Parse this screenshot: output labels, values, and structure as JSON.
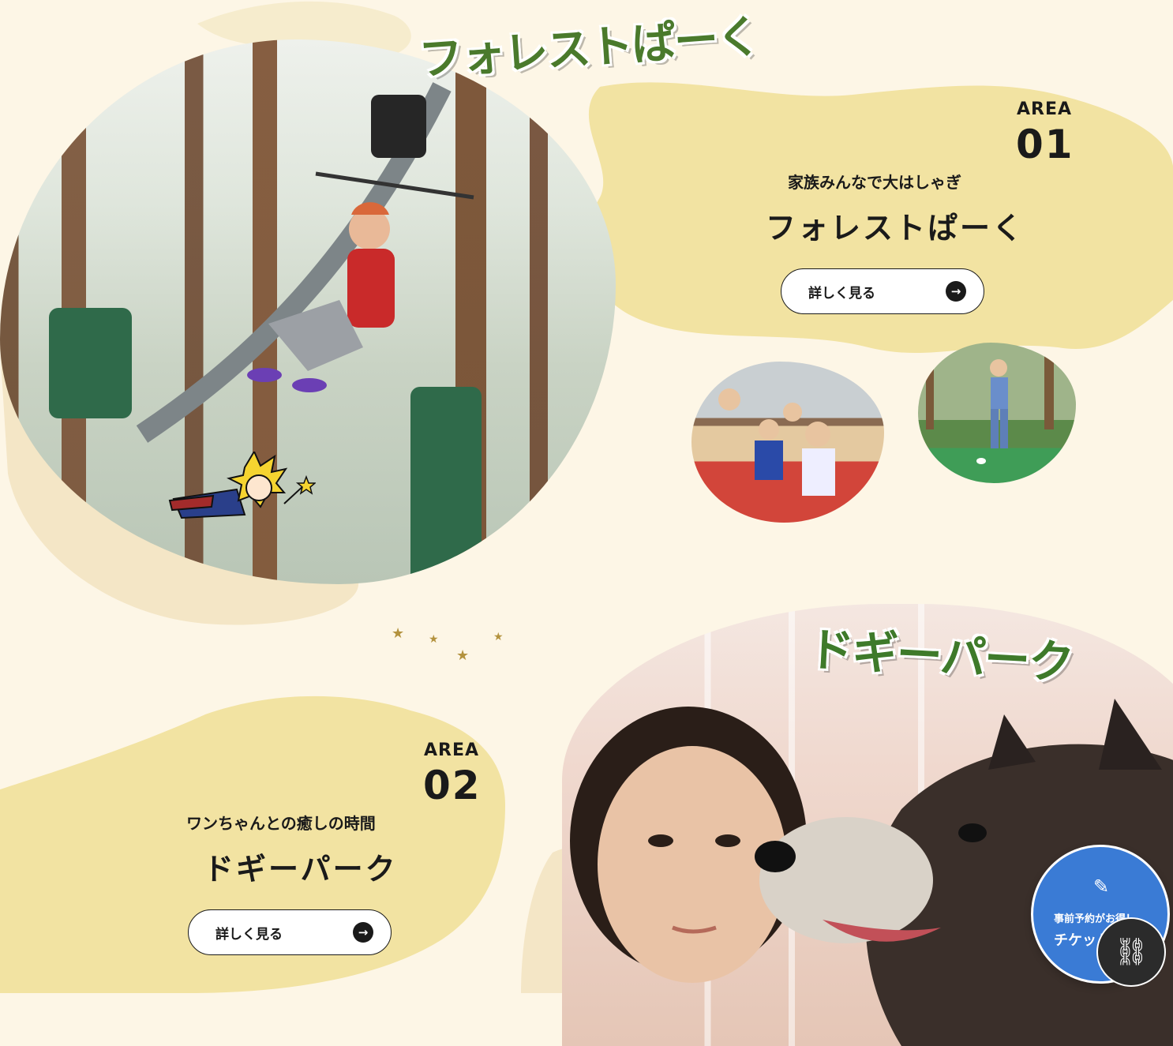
{
  "colors": {
    "background": "#fdf6e6",
    "yellow_blob": "#f2e3a2",
    "sand_blob": "#f4e6c6",
    "logo_green": "#4a7a2c",
    "ticket_blue": "#3a7bd5",
    "star_gold": "#b3923e"
  },
  "area1": {
    "logo_text": "フォレストぱーく",
    "area_label": "AREA",
    "area_number": "01",
    "tagline": "家族みんなで大はしゃぎ",
    "title": "フォレストぱーく",
    "button_label": "詳しく見る",
    "button_icon": "arrow-right-icon"
  },
  "area2": {
    "logo_text": "ドギーパーク",
    "area_label": "AREA",
    "area_number": "02",
    "tagline": "ワンちゃんとの癒しの時間",
    "title": "ドギーパーク",
    "button_label": "詳しく見る",
    "button_icon": "arrow-right-icon"
  },
  "decor": {
    "star_glyph": "★"
  },
  "floating": {
    "ticket_line1": "事前予約がお得！",
    "ticket_line2": "チケット",
    "ticket_icon": "ticket-icon",
    "link_icon": "link-icon"
  }
}
